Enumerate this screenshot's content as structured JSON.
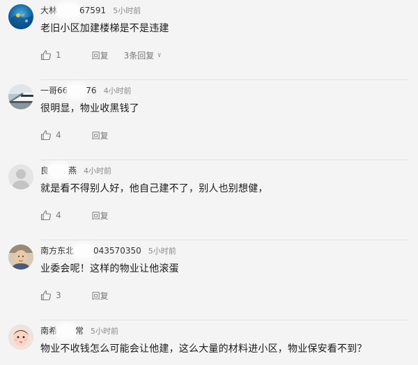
{
  "comments": [
    {
      "user_prefix": "大林",
      "user_suffix": "67591",
      "time": "5小时前",
      "text": "老旧小区加建楼梯是不是违建",
      "likes": "1",
      "reply_label": "回复",
      "replies_label": "3条回复",
      "avatar": "ocean-photo"
    },
    {
      "user_prefix": "一哥66",
      "user_suffix": "76",
      "time": "4小时前",
      "text": "很明显，物业收黑钱了",
      "likes": "4",
      "reply_label": "回复",
      "avatar": "train-photo"
    },
    {
      "user_prefix": "良",
      "user_suffix": "燕",
      "time": "4小时前",
      "text": "就是看不得别人好，他自己建不了，别人也别想健，",
      "likes": "4",
      "reply_label": "回复",
      "avatar": "default-person"
    },
    {
      "user_prefix": "南方东北",
      "user_suffix": "043570350",
      "time": "5小时前",
      "text": "业委会呢！这样的物业让他滚蛋",
      "likes": "3",
      "reply_label": "回复",
      "avatar": "elder-photo"
    },
    {
      "user_prefix": "南希",
      "user_suffix": "常",
      "time": "5小时前",
      "text": "物业不收钱怎么可能会让他建，这么大量的材料进小区，物业保安看不到？",
      "avatar": "baby-photo"
    }
  ],
  "colors": {
    "background": "#f4f4f4",
    "text": "#1a1a1a",
    "meta": "#8a8a8a",
    "action": "#777777",
    "divider": "#e2e2e2"
  }
}
